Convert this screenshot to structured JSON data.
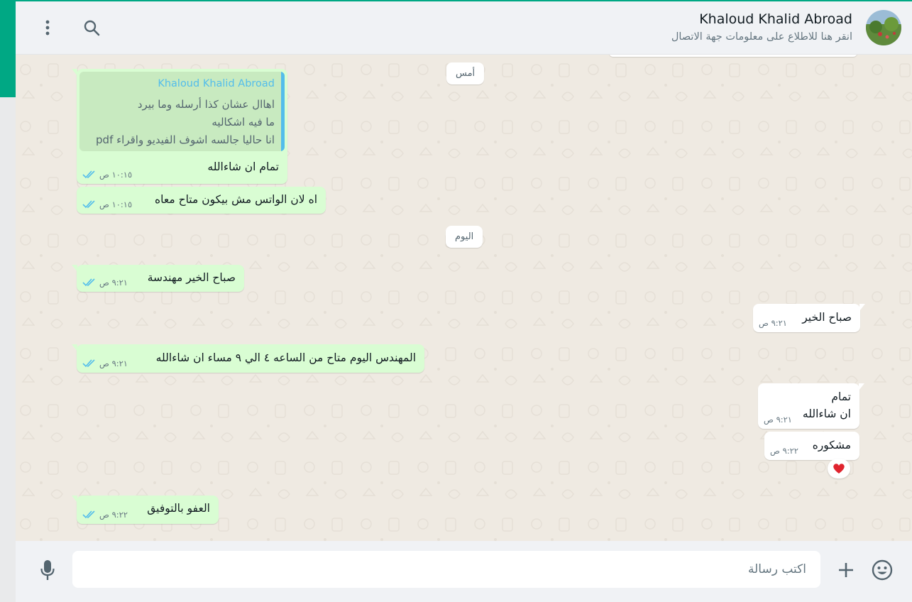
{
  "contact": {
    "name": "Khaloud Khalid Abroad",
    "subtitle": "انقر هنا للاطلاع على معلومات جهة الاتصال"
  },
  "header_icons": [
    "menu-icon",
    "search-icon"
  ],
  "date_separators": {
    "yesterday": "أمس",
    "today": "اليوم"
  },
  "messages": {
    "m1": {
      "direction": "sent",
      "quote": {
        "author": "Khaloud Khalid Abroad",
        "lines": [
          "اهاال عشان كذا أرسله وما بيرد",
          "ما فيه اشكاليه",
          "انا حاليا جالسه اشوف الفيديو واقراء pdf"
        ]
      },
      "text": "تمام ان شاءالله",
      "time": "١٠:١٥ ص",
      "status": "read"
    },
    "m2": {
      "direction": "sent",
      "text": "اه لان الواتس مش بيكون متاح معاه",
      "time": "١٠:١٥ ص",
      "status": "read"
    },
    "m3": {
      "direction": "sent",
      "text": "صباح الخير مهندسة",
      "time": "٩:٢١ ص",
      "status": "read"
    },
    "m4": {
      "direction": "received",
      "text": "صباح الخير",
      "time": "٩:٢١ ص"
    },
    "m5": {
      "direction": "sent",
      "text": "المهندس اليوم متاح من الساعه ٤ الي ٩ مساء ان شاءالله",
      "time": "٩:٢١ ص",
      "status": "read"
    },
    "m6": {
      "direction": "received",
      "lines": [
        "تمام",
        "ان شاءالله"
      ],
      "time": "٩:٢١ ص"
    },
    "m7": {
      "direction": "received",
      "text": "مشكوره",
      "time": "٩:٢٢ ص",
      "reaction": "❤️"
    },
    "m8": {
      "direction": "sent",
      "text": "العفو بالتوفيق",
      "time": "٩:٢٢ ص",
      "status": "read"
    }
  },
  "composer": {
    "placeholder": "اكتب رسالة",
    "icons": [
      "emoji-icon",
      "plus-icon",
      "microphone-icon"
    ]
  },
  "colors": {
    "accent": "#00a884",
    "sent_bubble": "#d9fdd3",
    "received_bubble": "#ffffff",
    "read_tick": "#53bdeb",
    "chat_background": "#efeae2"
  }
}
